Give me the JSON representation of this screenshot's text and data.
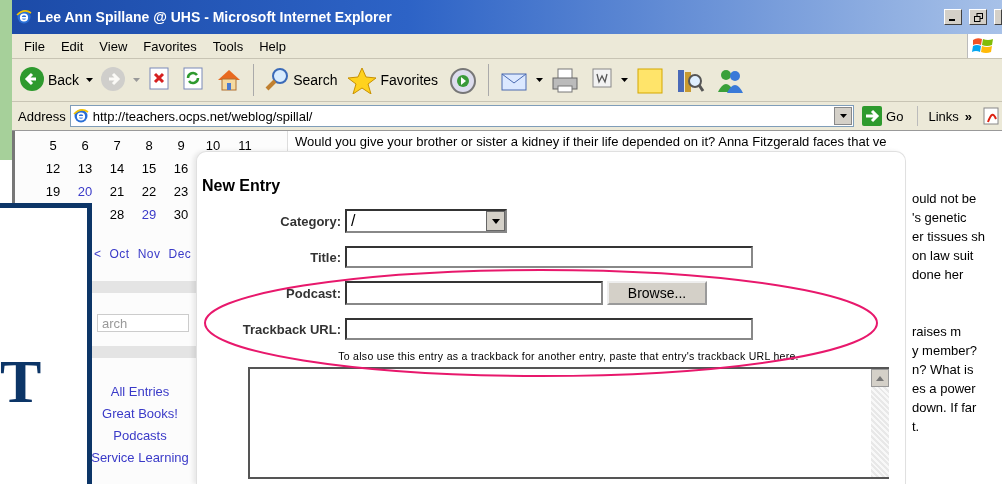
{
  "window": {
    "title": "Lee Ann Spillane @ UHS - Microsoft Internet Explorer"
  },
  "menu": [
    "File",
    "Edit",
    "View",
    "Favorites",
    "Tools",
    "Help"
  ],
  "toolbar": [
    {
      "kind": "back",
      "label": "Back",
      "dropdown": true
    },
    {
      "kind": "forward",
      "dropdown": true,
      "disabled": true
    },
    {
      "kind": "stop"
    },
    {
      "kind": "refresh"
    },
    {
      "kind": "home"
    },
    {
      "kind": "search",
      "label": "Search"
    },
    {
      "kind": "favorites",
      "label": "Favorites"
    },
    {
      "kind": "media"
    },
    {
      "kind": "mail",
      "dropdown": true
    },
    {
      "kind": "print"
    },
    {
      "kind": "edit",
      "dropdown": true
    },
    {
      "kind": "note"
    },
    {
      "kind": "research"
    },
    {
      "kind": "messenger"
    }
  ],
  "address_bar": {
    "label": "Address",
    "url": "http://teachers.ocps.net/weblog/spillal/",
    "go": "Go",
    "links": "Links",
    "links_more": "»"
  },
  "calendar": {
    "weeks": [
      [
        {
          "day": "5",
          "link": false
        },
        {
          "day": "6",
          "link": false
        },
        {
          "day": "7",
          "link": false
        },
        {
          "day": "8",
          "link": false
        },
        {
          "day": "9",
          "link": false
        },
        {
          "day": "10",
          "link": false
        },
        {
          "day": "11",
          "link": false
        }
      ],
      [
        {
          "day": "12",
          "link": false
        },
        {
          "day": "13",
          "link": false
        },
        {
          "day": "14",
          "link": false
        },
        {
          "day": "15",
          "link": false
        },
        {
          "day": "16",
          "link": false
        }
      ],
      [
        {
          "day": "19",
          "link": false
        },
        {
          "day": "20",
          "link": true
        },
        {
          "day": "21",
          "link": false
        },
        {
          "day": "22",
          "link": false
        },
        {
          "day": "23",
          "link": false
        }
      ],
      [
        {
          "day": "28",
          "link": false
        },
        {
          "day": "29",
          "link": true
        },
        {
          "day": "30",
          "link": false
        }
      ]
    ],
    "nav": [
      "<",
      "Oct",
      "Nov",
      "Dec"
    ]
  },
  "sidebar": {
    "search": {
      "placeholder": "arch"
    },
    "links": [
      "All Entries",
      "Great Books!",
      "Podcasts",
      "Service Learning"
    ]
  },
  "article": {
    "paragraphs": [
      [
        {
          "kind": "full",
          "text": "Would you give your brother or sister a kidney if their life depended on it? Anna Fitzgerald faces that ve"
        }
      ],
      [
        {
          "kind": "tail",
          "text": "ould not be"
        },
        {
          "kind": "tail",
          "text": "'s genetic"
        },
        {
          "kind": "tail",
          "text": "er tissues sh"
        },
        {
          "kind": "tail",
          "text": "on law suit"
        },
        {
          "kind": "tail",
          "text": "done her"
        }
      ],
      [
        {
          "kind": "tail",
          "text": "raises m"
        },
        {
          "kind": "tail",
          "text": "y member?"
        },
        {
          "kind": "tail",
          "text": "n? What is"
        },
        {
          "kind": "tail",
          "text": "es a power"
        },
        {
          "kind": "tail",
          "text": "down. If far"
        },
        {
          "kind": "tail",
          "text": "t."
        }
      ]
    ]
  },
  "entry_form": {
    "title": "New Entry",
    "fields": [
      {
        "kind": "select",
        "label": "Category:",
        "value": "/"
      },
      {
        "kind": "text",
        "label": "Title:"
      },
      {
        "kind": "file",
        "label": "Podcast:",
        "button": "Browse..."
      },
      {
        "kind": "text",
        "label": "Trackback URL:"
      }
    ],
    "hint": "To also use this entry as a trackback for another entry, paste that entry's trackback URL here."
  },
  "slide": {
    "heading": "T"
  }
}
